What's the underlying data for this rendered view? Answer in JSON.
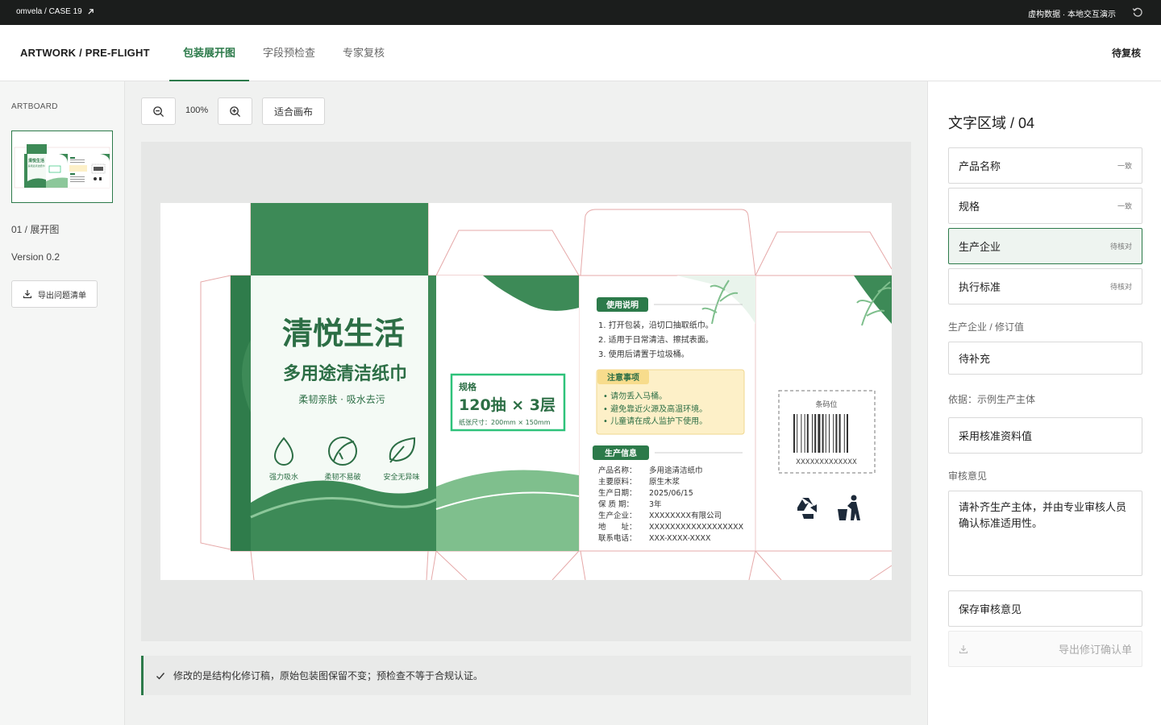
{
  "topbar": {
    "crumb": "omvela / CASE 19",
    "notice": "虚构数据 · 本地交互演示"
  },
  "header": {
    "app_title": "ARTWORK / PRE-FLIGHT",
    "tabs": [
      {
        "label": "包装展开图",
        "active": true
      },
      {
        "label": "字段预检查",
        "active": false
      },
      {
        "label": "专家复核",
        "active": false
      }
    ],
    "status": "待复核"
  },
  "sidebar": {
    "section_label": "ARTBOARD",
    "page": "01 / 展开图",
    "version": "Version 0.2",
    "export_issues": "导出问题清单"
  },
  "toolbar": {
    "zoom": "100%",
    "fit": "适合画布"
  },
  "artwork": {
    "brand": "清悦生活",
    "product": "多用途清洁纸巾",
    "slogan": "柔韧亲肤 · 吸水去污",
    "features": [
      "强力吸水",
      "柔韧不易破",
      "安全无异味"
    ],
    "spec_label": "规格",
    "spec_value": "120抽 × 3层",
    "spec_size": "纸张尺寸：200mm × 150mm",
    "usage_title": "使用说明",
    "usage": [
      "1. 打开包装，沿切口抽取纸巾。",
      "2. 适用于日常清洁、擦拭表面。",
      "3. 使用后请置于垃圾桶。"
    ],
    "caution_title": "注意事项",
    "caution": [
      "• 请勿丢入马桶。",
      "• 避免靠近火源及高温环境。",
      "• 儿童请在成人监护下使用。"
    ],
    "info_title": "生产信息",
    "info": [
      {
        "k": "产品名称：",
        "v": "多用途清洁纸巾"
      },
      {
        "k": "主要原料：",
        "v": "原生木浆"
      },
      {
        "k": "生产日期：",
        "v": "2025/06/15"
      },
      {
        "k": "保 质 期：",
        "v": "3年"
      },
      {
        "k": "生产企业：",
        "v": "XXXXXXXX有限公司"
      },
      {
        "k": "地　　址：",
        "v": "XXXXXXXXXXXXXXXXXX"
      },
      {
        "k": "联系电话：",
        "v": "XXX-XXXX-XXXX"
      }
    ],
    "barcode_label": "条码位",
    "barcode_number": "XXXXXXXXXXXXX"
  },
  "notice": "修改的是结构化修订稿，原始包装图保留不变；预检查不等于合规认证。",
  "panel": {
    "title": "文字区域",
    "count": "04",
    "fields": [
      {
        "name": "产品名称",
        "status": "一致",
        "selected": false
      },
      {
        "name": "规格",
        "status": "一致",
        "selected": false
      },
      {
        "name": "生产企业",
        "status": "待核对",
        "selected": true
      },
      {
        "name": "执行标准",
        "status": "待核对",
        "selected": false
      }
    ],
    "revision_label": "生产企业 / 修订值",
    "revision_value": "待补充",
    "basis": "依据：示例生产主体",
    "adopt": "采用核准资料值",
    "comment_label": "审核意见",
    "comment": "请补齐生产主体，并由专业审核人员确认标准适用性。",
    "save": "保存审核意见",
    "export_revision": "导出修订确认单"
  },
  "colors": {
    "brand_green": "#2c7a4a",
    "light_green": "#7fbf8d",
    "topbar": "#1b1d1c"
  }
}
